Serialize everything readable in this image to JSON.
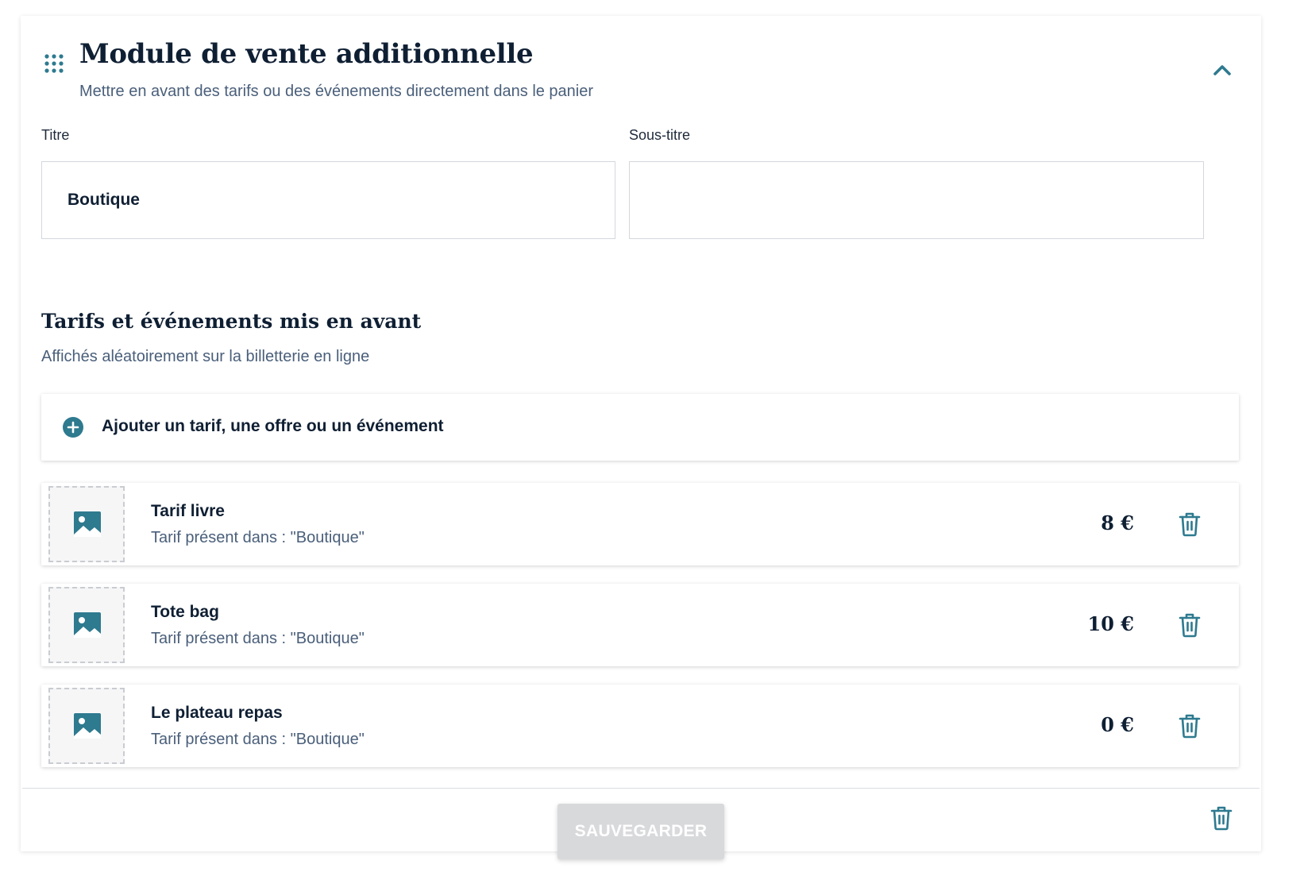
{
  "module": {
    "title": "Module de vente additionnelle",
    "subtitle": "Mettre en avant des tarifs ou des événements directement dans le panier"
  },
  "form": {
    "title_label": "Titre",
    "title_value": "Boutique",
    "subtitle_label": "Sous-titre",
    "subtitle_value": ""
  },
  "featured": {
    "heading": "Tarifs et événements mis en avant",
    "description": "Affichés aléatoirement sur la billetterie en ligne",
    "add_label": "Ajouter un tarif, une offre ou un événement",
    "items": [
      {
        "name": "Tarif livre",
        "description": "Tarif présent dans : \"Boutique\"",
        "price": "8 €"
      },
      {
        "name": "Tote bag",
        "description": "Tarif présent dans : \"Boutique\"",
        "price": "10 €"
      },
      {
        "name": "Le plateau repas",
        "description": "Tarif présent dans : \"Boutique\"",
        "price": "0 €"
      }
    ]
  },
  "footer": {
    "save_label": "SAUVEGARDER"
  },
  "colors": {
    "accent": "#2e7a8f",
    "heading": "#0f1f33",
    "muted_text": "#4a5f7a",
    "disabled_button": "#d8d9db"
  },
  "icons": {
    "drag": "drag-handle-icon",
    "collapse": "chevron-up-icon",
    "add": "plus-circle-icon",
    "image": "image-placeholder-icon",
    "delete": "trash-icon"
  }
}
